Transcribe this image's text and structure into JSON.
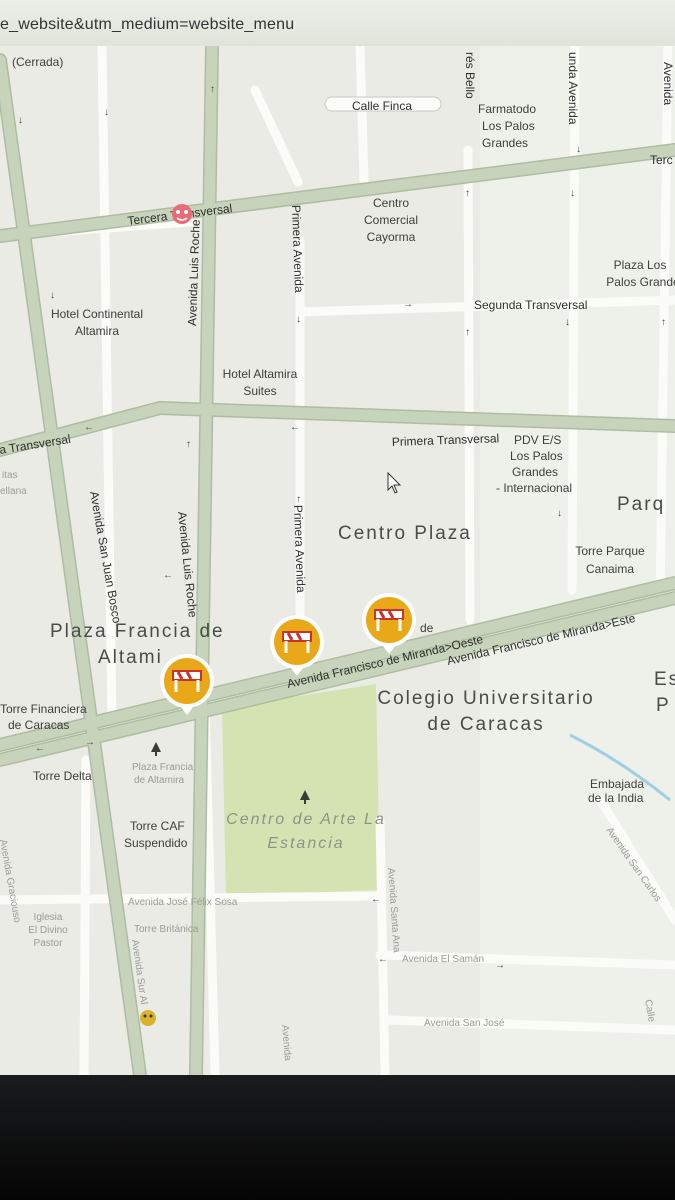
{
  "browser": {
    "url_fragment": "e_website&utm_medium=website_menu"
  },
  "map": {
    "streets": {
      "tercera_transversal": "Tercera Transversal",
      "tercera_right": "Terc",
      "segunda_transversal": "Segunda Transversal",
      "primera_transversal": "Primera Transversal",
      "primera_transversal_left": "a Transversal",
      "calle_finca": "Calle Finca",
      "avenida_luis_roche_1": "Avenida Luis Roche",
      "avenida_luis_roche_2": "Avenida Luis Roche",
      "primera_avenida_1": "Primera Avenida",
      "primera_avenida_2": "Primera Avenida",
      "avenida_san_juan_bosco": "Avenida San Juan Bosco",
      "avenida_bello": "rés Bello",
      "avenida_top": "unda Avenida",
      "avenida_far_right": "Avenida",
      "francisco_miranda_oeste": "Avenida Francisco de Miranda>Oeste",
      "francisco_miranda_este": "Avenida Francisco de Miranda>Este",
      "jose_felix_sosa": "Avenida José Félix Sosa",
      "avenida_el_saman": "Avenida El Samán",
      "avenida_san_jose": "Avenida San José",
      "avenida_santa_ana": "Avenida Santa Ana",
      "avenida_san_carlos": "Avenida San Carlos",
      "avenida_sur": "Avenida Sur Al",
      "avenida_left": "Avenida Graciouso",
      "calle_right": "Calle",
      "calle_bottom": "Avenida"
    },
    "places": {
      "cerrada": "(Cerrada)",
      "farmatodo": [
        "Farmatodo",
        "Los Palos",
        "Grandes"
      ],
      "centro_comercial": [
        "Centro",
        "Comercial",
        "Cayorma"
      ],
      "plaza_palos_grandes": [
        "Plaza Los",
        "Palos Grandes"
      ],
      "hotel_continental": [
        "Hotel Continental",
        "Altamira"
      ],
      "hotel_altamira_suites": [
        "Hotel Altamira",
        "Suites"
      ],
      "pdv": [
        "PDV E/S",
        "Los Palos",
        "Grandes",
        "- Internacional"
      ],
      "torre_parque_canaima": [
        "Torre Parque",
        "Canaima"
      ],
      "ritas": [
        "itas",
        "ellana"
      ],
      "torre_financiera": [
        "Torre Financiera",
        "de Caracas"
      ],
      "torre_delta": "Torre Delta",
      "plaza_francia_small": [
        "Plaza Francia",
        "de Altamira"
      ],
      "torre_caf": [
        "Torre CAF",
        "Suspendido"
      ],
      "iglesia": [
        "Iglesia",
        "El Divino",
        "Pastor"
      ],
      "torre_britanica": "Torre Británica",
      "embajada": [
        "Embajada",
        "de la India"
      ],
      "de_label": "de"
    },
    "areas": {
      "centro_plaza": "Centro Plaza",
      "plaza_francia": [
        "Plaza Francia de",
        "Altami"
      ],
      "colegio": [
        "Colegio Universitario",
        "de Caracas"
      ],
      "centro_arte": [
        "Centro de Arte La",
        "Estancia"
      ],
      "parque": "Parq",
      "es_right": [
        "Es",
        "P"
      ]
    },
    "markers": {
      "roadwork_count": 3,
      "roadwork_icon": "roadwork-barrier-icon",
      "marker_color": "#e9a817",
      "barrier_color": "#c8332a"
    },
    "colors": {
      "map_bg": "#e9ebe4",
      "main_road": "#c7d3ba",
      "main_road_edge": "#aebda0",
      "minor_road": "#ffffff",
      "park": "#d3e3b0"
    }
  }
}
